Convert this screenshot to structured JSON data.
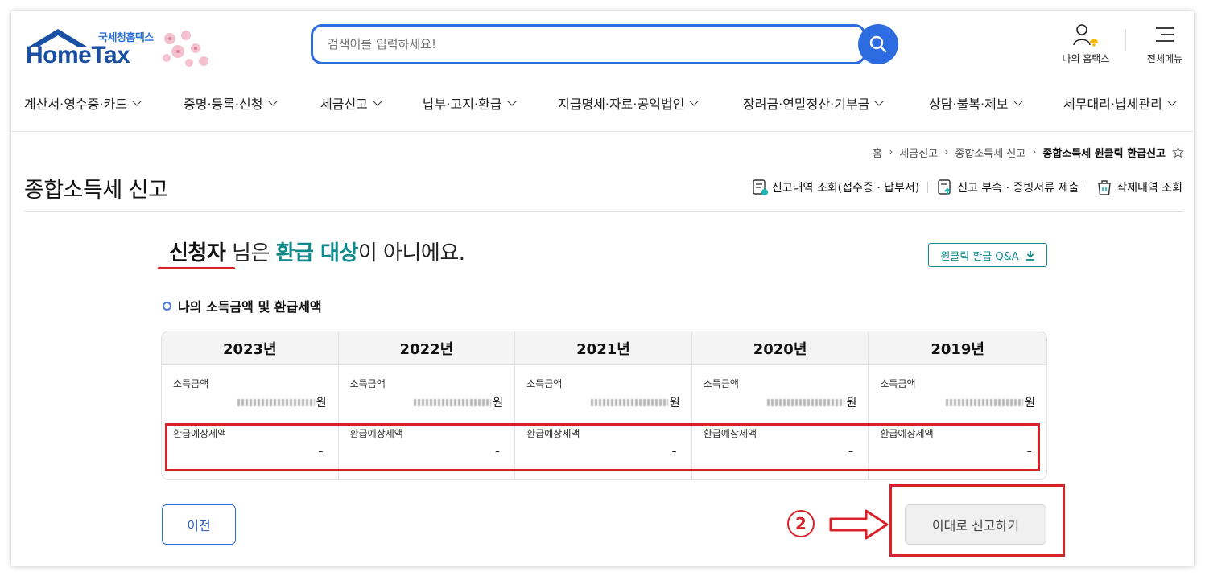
{
  "header": {
    "logo_sub": "국세청홈택스",
    "logo_main": "HomeTax",
    "search_placeholder": "검색어를 입력하세요!",
    "my_hometax": "나의 홈택스",
    "all_menu": "전체메뉴"
  },
  "gnb": [
    {
      "label": "계산서·영수증·카드"
    },
    {
      "label": "증명·등록·신청"
    },
    {
      "label": "세금신고"
    },
    {
      "label": "납부·고지·환급"
    },
    {
      "label": "지급명세·자료·공익법인"
    },
    {
      "label": "장려금·연말정산·기부금"
    },
    {
      "label": "상담·불복·제보"
    },
    {
      "label": "세무대리·납세관리"
    }
  ],
  "breadcrumb": [
    "홈",
    "세금신고",
    "종합소득세 신고",
    "종합소득세 원클릭 환급신고"
  ],
  "breadcrumb_sep": "›",
  "page_title": "종합소득세 신고",
  "page_links": [
    "신고내역 조회(접수증 · 납부서)",
    "신고 부속 · 증빙서류 제출",
    "삭제내역 조회"
  ],
  "headline": {
    "name": "신청자",
    "part1": " 님은 ",
    "highlight": "환급 대상",
    "part2": "이 아니에요."
  },
  "qa_button": "원클릭 환급 Q&A",
  "section_title": "나의 소득금액 및 환급세액",
  "income_label": "소득금액",
  "refund_label": "환급예상세액",
  "currency": "원",
  "years": [
    {
      "year": "2023년",
      "refund": "-"
    },
    {
      "year": "2022년",
      "refund": "-"
    },
    {
      "year": "2021년",
      "refund": "-"
    },
    {
      "year": "2020년",
      "refund": "-"
    },
    {
      "year": "2019년",
      "refund": "-"
    }
  ],
  "prev_button": "이전",
  "step_number": "2",
  "submit_button": "이대로 신고하기",
  "colors": {
    "brand_blue": "#2d6be0",
    "teal": "#0e8a8c",
    "annotation_red": "#d9212a"
  }
}
